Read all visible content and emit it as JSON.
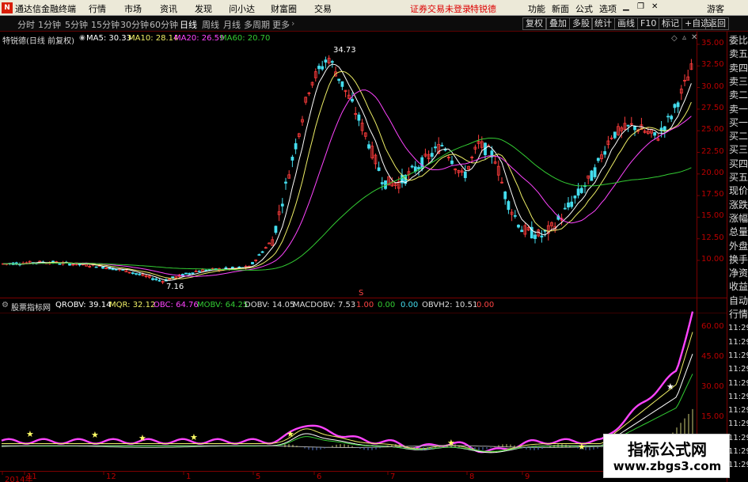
{
  "menubar": {
    "logo": "N",
    "app_title": "通达信金融终端",
    "items": [
      "行情",
      "市场",
      "资讯",
      "发现",
      "问小达",
      "财富圈",
      "交易"
    ],
    "login_notice": "证券交易未登录",
    "stock_name": "特锐德",
    "tools": [
      "功能",
      "新面",
      "公式",
      "选项"
    ],
    "guest": "游客"
  },
  "periodbar": {
    "periods": [
      "分时",
      "1分钟",
      "5分钟",
      "15分钟",
      "30分钟",
      "60分钟",
      "日线",
      "周线",
      "月线",
      "多周期",
      "更多"
    ],
    "active": "日线",
    "right_buttons": [
      "复权",
      "叠加",
      "多股",
      "统计",
      "画线",
      "F10",
      "标记",
      "+自选",
      "返回"
    ]
  },
  "main_info": {
    "title": "特锐德(日线 前复权)",
    "ma5": "MA5: 30.33",
    "ma10": "MA10: 28.14",
    "ma20": "MA20: 26.59",
    "ma60": "MA60: 20.70",
    "high_label": "34.73",
    "low_label": "7.16",
    "s_marker": "S"
  },
  "ind_info": {
    "title": "股票指标网",
    "qrobv": "QROBV: 39.14",
    "mqr": "MQR: 32.12",
    "obc": "OBC: 64.76",
    "mobv": "MOBV: 64.25",
    "dobv": "DOBV: 14.05",
    "macdobv": "MACDOBV: 7.53",
    "v1": "1.00",
    "v2": "0.00",
    "v3": "0.00",
    "obvh2": "OBVH2: 10.51",
    "v4": "0.00"
  },
  "price_axis": [
    "35.00",
    "32.50",
    "30.00",
    "27.50",
    "25.00",
    "22.50",
    "20.00",
    "17.50",
    "15.00",
    "12.50",
    "10.00"
  ],
  "ind_axis": [
    "60.00",
    "45.00",
    "30.00",
    "15.00"
  ],
  "date_axis": [
    "2014年",
    "11",
    "12",
    "1",
    "5",
    "6",
    "7",
    "8",
    "9"
  ],
  "right_panel": [
    "委比",
    "卖五",
    "卖四",
    "卖三",
    "卖二",
    "卖一",
    "买一",
    "买二",
    "买三",
    "买四",
    "买五",
    "现价",
    "涨跌",
    "涨幅",
    "总量",
    "外盘",
    "换手",
    "净资",
    "收益",
    "自动",
    "行情",
    "11:29",
    "11:29",
    "11:29",
    "11:29",
    "11:29",
    "11:29",
    "11:29",
    "11:29",
    "11:29",
    "11:29",
    "11:29"
  ],
  "watermark": {
    "line1": "指标公式网",
    "line2": "www.zbgs3.com"
  },
  "colors": {
    "up": "#ff3c3c",
    "down": "#44ddee",
    "ma5": "#ffffff",
    "ma10": "#eeee66",
    "ma20": "#ff44ff",
    "ma60": "#33cc33",
    "axis": "#aa0000"
  }
}
